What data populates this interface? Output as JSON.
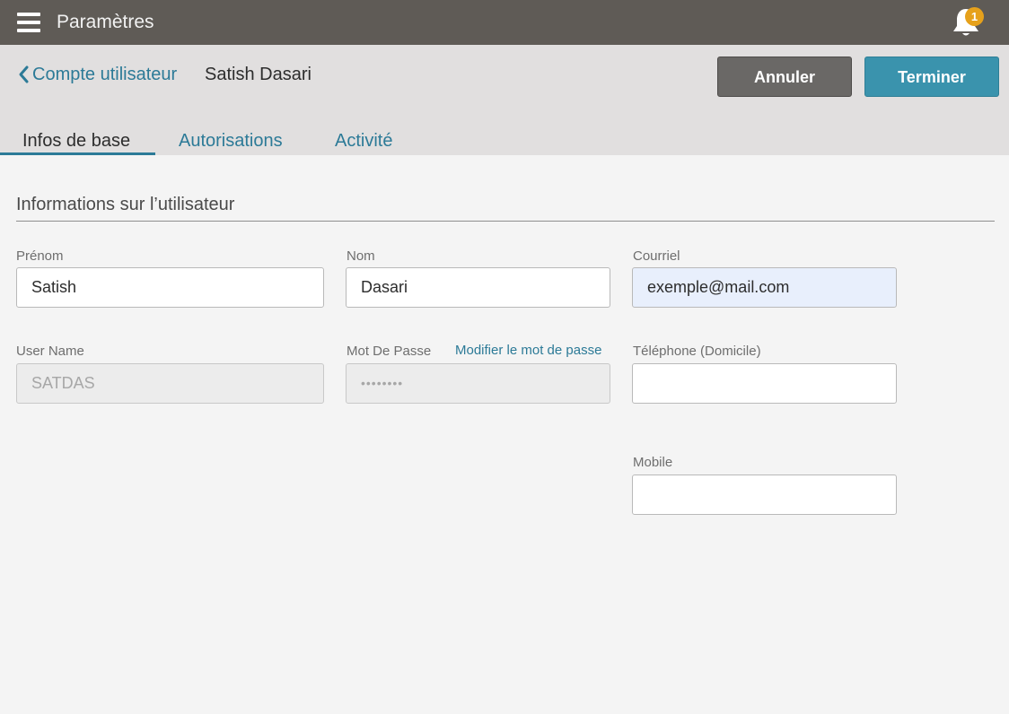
{
  "topbar": {
    "title": "Paramètres",
    "notification_count": "1"
  },
  "header": {
    "back_label": "Compte utilisateur",
    "user_name": "Satish Dasari",
    "cancel_label": "Annuler",
    "finish_label": "Terminer"
  },
  "tabs": [
    {
      "label": "Infos de base",
      "active": true
    },
    {
      "label": "Autorisations",
      "active": false
    },
    {
      "label": "Activité",
      "active": false
    }
  ],
  "section": {
    "title": "Informations sur l’utilisateur"
  },
  "fields": {
    "first_name": {
      "label": "Prénom",
      "value": "Satish"
    },
    "last_name": {
      "label": "Nom",
      "value": "Dasari"
    },
    "email": {
      "label": "Courriel",
      "value": "exemple@mail.com"
    },
    "username": {
      "label": "User Name",
      "value": "SATDAS"
    },
    "password": {
      "label": "Mot De Passe",
      "value": "••••••••",
      "change_link": "Modifier le mot de passe"
    },
    "home_phone": {
      "label": "Téléphone (Domicile)",
      "value": ""
    },
    "mobile": {
      "label": "Mobile",
      "value": ""
    }
  },
  "colors": {
    "topbar": "#5f5b56",
    "accent": "#2c7a97",
    "primary_button": "#3a93ad",
    "badge": "#e6a11b"
  }
}
